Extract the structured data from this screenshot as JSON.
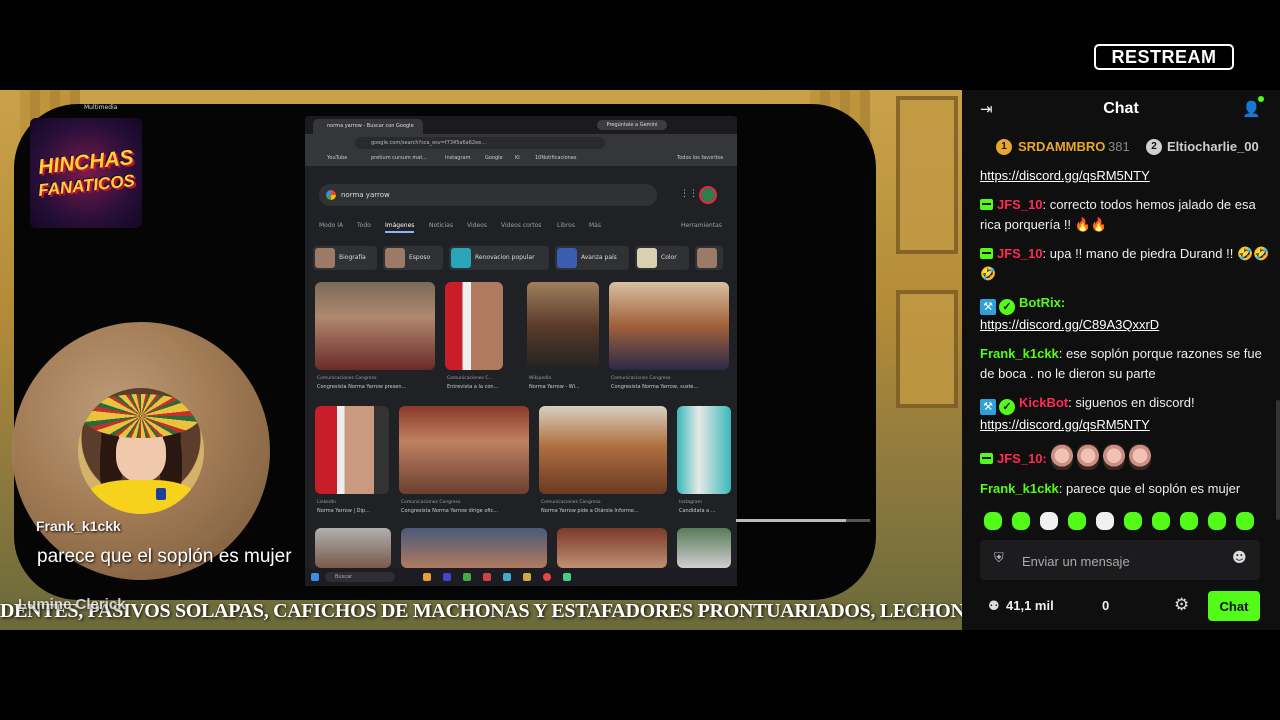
{
  "branding": {
    "restream": "RESTREAM",
    "hinchas_line1": "HINCHAS",
    "hinchas_line2": "FANATICOS",
    "multimedia": "Multimedia"
  },
  "browser": {
    "tab_title": "norma yarrow - Buscar con Google",
    "gemini_button": "Pregúntale a Gemini",
    "url": "google.com/search?sca_esv=f7345a6a62ee...",
    "bookmarks": [
      "YouTube",
      "pretium cursum mat...",
      "Instagram",
      "Google",
      "Kl",
      "10Notificaciones",
      "Todos los favoritos"
    ],
    "search_query": "norma yarrow",
    "filters": [
      "Modo IA",
      "Todo",
      "Imágenes",
      "Noticias",
      "Videos",
      "Videos cortos",
      "Libros",
      "Más"
    ],
    "active_filter": "Imágenes",
    "tools": "Herramientas",
    "chips": [
      "Biografía",
      "Esposo",
      "Renovacion popular",
      "Avanza país",
      "Color"
    ],
    "row1_captions": [
      {
        "source": "Comunicaciones Congreso",
        "title": "Congresista Norma Yarrow presen..."
      },
      {
        "source": "Comunicaciones C...",
        "title": "Entrevista a la con..."
      },
      {
        "source": "Wikipedia",
        "title": "Norma Yarrow - Wi..."
      },
      {
        "source": "Comunicaciones Congreso",
        "title": "Congresista Norma Yarrow, suste..."
      }
    ],
    "row2_captions": [
      {
        "source": "LinkedIn",
        "title": "Norma Yarrow | Dip..."
      },
      {
        "source": "Comunicaciones Congreso",
        "title": "Congresista Norma Yarrow dirige ofic..."
      },
      {
        "source": "Comunicaciones Congreso",
        "title": "Norma Yarrow pide a Otárola Informe..."
      },
      {
        "source": "Instagram",
        "title": "Candidata a ..."
      }
    ],
    "taskbar_search": "Buscar"
  },
  "overlay": {
    "username": "Frank_k1ckk",
    "message": "parece que el soplón es mujer",
    "streamer_name": "Lumine Clerick",
    "ticker": "DENTES, PASIVOS SOLAPAS, CAFICHOS DE MACHONAS Y ESTAFADORES PRONTUARIADOS, LECHONAS DIVORCIADAS CARENTES"
  },
  "chat": {
    "title": "Chat",
    "leaderboard": [
      {
        "rank": "1",
        "name": "SRDAMMBRO",
        "points": "381",
        "color": "#e8a72a"
      },
      {
        "rank": "2",
        "name": "Eltiocharlie_00",
        "points": "",
        "color": "#cfcfcf"
      }
    ],
    "messages": [
      {
        "kind": "link",
        "text": "https://discord.gg/qsRM5NTY"
      },
      {
        "kind": "msg",
        "user": "JFS_10",
        "user_color": "#ff2a55",
        "text": ": correcto todos hemos jalado de esa rica porquería !! 🔥🔥"
      },
      {
        "kind": "msg",
        "user": "JFS_10",
        "user_color": "#ff2a55",
        "text": ": upa !! mano de piedra Durand !! 🤣🤣🤣"
      },
      {
        "kind": "bot",
        "user": "BotRix",
        "user_color": "#53fc18",
        "link": "https://discord.gg/C89A3QxxrD"
      },
      {
        "kind": "msg",
        "user": "Frank_k1ckk",
        "user_color": "#53fc18",
        "text": ": ese soplón porque razones se fue de boca . no le dieron su parte"
      },
      {
        "kind": "bot",
        "user": "KickBot",
        "user_color": "#ff2a55",
        "text": ": siguenos en discord!",
        "link": "https://discord.gg/qsRM5NTY"
      },
      {
        "kind": "emotes",
        "user": "JFS_10",
        "user_color": "#ff2a55",
        "count": 4
      },
      {
        "kind": "msg",
        "user": "Frank_k1ckk",
        "user_color": "#53fc18",
        "text": ": parece que el soplón es mujer"
      }
    ],
    "input_placeholder": "Enviar un mensaje",
    "viewers": "41,1 mil",
    "secondary_count": "0",
    "chat_button": "Chat",
    "accent": "#53fc18"
  },
  "icons": [
    "collapse-icon",
    "users-icon",
    "shield-icon",
    "smiley-icon",
    "viewers-icon",
    "settings-icon"
  ]
}
